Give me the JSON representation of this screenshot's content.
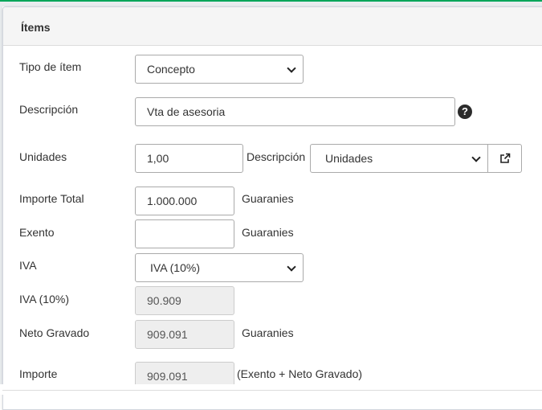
{
  "panel": {
    "title": "Ítems"
  },
  "form": {
    "tipo_item": {
      "label": "Tipo de ítem",
      "value": "Concepto"
    },
    "descripcion": {
      "label": "Descripción",
      "value": "Vta de asesoria"
    },
    "unidades": {
      "label": "Unidades",
      "value": "1,00",
      "desc_label": "Descripción",
      "unit_value": "Unidades"
    },
    "importe_total": {
      "label": "Importe Total",
      "value": "1.000.000",
      "currency": "Guaranies"
    },
    "exento": {
      "label": "Exento",
      "value": "",
      "currency": "Guaranies"
    },
    "iva": {
      "label": "IVA",
      "value": "IVA (10%)"
    },
    "iva_10": {
      "label": "IVA (10%)",
      "value": "90.909"
    },
    "neto_gravado": {
      "label": "Neto Gravado",
      "value": "909.091",
      "currency": "Guaranies"
    },
    "importe": {
      "label": "Importe",
      "value": "909.091",
      "note": "(Exento + Neto Gravado)"
    }
  },
  "icons": {
    "help": "question-circle-icon",
    "external": "external-link-icon",
    "help_glyph": "?"
  }
}
